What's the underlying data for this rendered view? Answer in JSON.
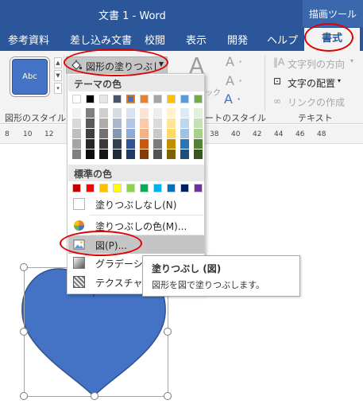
{
  "window": {
    "title": "文書 1  -  Word",
    "tool_tab": "描画ツール"
  },
  "tabs": [
    {
      "label": "参考資料"
    },
    {
      "label": "差し込み文書"
    },
    {
      "label": "校閲"
    },
    {
      "label": "表示"
    },
    {
      "label": "開発"
    },
    {
      "label": "ヘルプ"
    },
    {
      "label": "書式",
      "active": true
    }
  ],
  "ribbon": {
    "shape_styles": {
      "preview_label": "Abc",
      "group_label": "図形のスタイル"
    },
    "shape_fill_button": {
      "label": "図形の塗りつぶし",
      "icon": "paint-bucket-icon"
    },
    "wordart": {
      "group_label": "ートのスタイル"
    },
    "text": {
      "direction": "文字列の方向",
      "align": "文字の配置",
      "link": "リンクの作成",
      "group_label": "テキスト"
    }
  },
  "ruler": {
    "ticks": [
      "8",
      "10",
      "12",
      "38",
      "40",
      "42",
      "44",
      "46",
      "48"
    ]
  },
  "fill_menu": {
    "theme_header": "テーマの色",
    "theme_top_row": [
      "#ffffff",
      "#000000",
      "#e7e6e6",
      "#44546a",
      "#4472c4",
      "#ed7d31",
      "#a5a5a5",
      "#ffc000",
      "#5b9bd5",
      "#70ad47"
    ],
    "theme_shades": [
      [
        "#f2f2f2",
        "#7f7f7f",
        "#d0cece",
        "#d6dce4",
        "#d9e2f3",
        "#fbe4d5",
        "#ededed",
        "#fff2cc",
        "#deebf6",
        "#e2efd9"
      ],
      [
        "#d8d8d8",
        "#595959",
        "#aeabab",
        "#adb9ca",
        "#b4c6e7",
        "#f7cbac",
        "#dbdbdb",
        "#fee599",
        "#bdd7ee",
        "#c5e0b3"
      ],
      [
        "#bfbfbf",
        "#3f3f3f",
        "#757070",
        "#8496b0",
        "#8eaadb",
        "#f4b183",
        "#c9c9c9",
        "#ffd965",
        "#9cc3e5",
        "#a8d08d"
      ],
      [
        "#a5a5a5",
        "#262626",
        "#3a3838",
        "#323f4f",
        "#2f5496",
        "#c55a11",
        "#7b7b7b",
        "#bf9000",
        "#2e75b5",
        "#538135"
      ],
      [
        "#7f7f7f",
        "#0c0c0c",
        "#171616",
        "#222a35",
        "#1f3864",
        "#833c0b",
        "#525252",
        "#7f6000",
        "#1e4e79",
        "#375623"
      ]
    ],
    "standard_header": "標準の色",
    "standard_colors": [
      "#c00000",
      "#ff0000",
      "#ffc000",
      "#ffff00",
      "#92d050",
      "#00b050",
      "#00b0f0",
      "#0070c0",
      "#002060",
      "#7030a0"
    ],
    "items": {
      "no_fill": "塗りつぶしなし(N)",
      "more_colors": "塗りつぶしの色(M)...",
      "picture": "図(P)...",
      "gradient": "グラデーション",
      "texture": "テクスチャ(T)"
    }
  },
  "tooltip": {
    "title": "塗りつぶし (図)",
    "description": "図形を図で塗りつぶします。"
  },
  "shape": {
    "fill": "#4472c4",
    "stroke": "#2f528f"
  },
  "highlight_color": "#e00000"
}
